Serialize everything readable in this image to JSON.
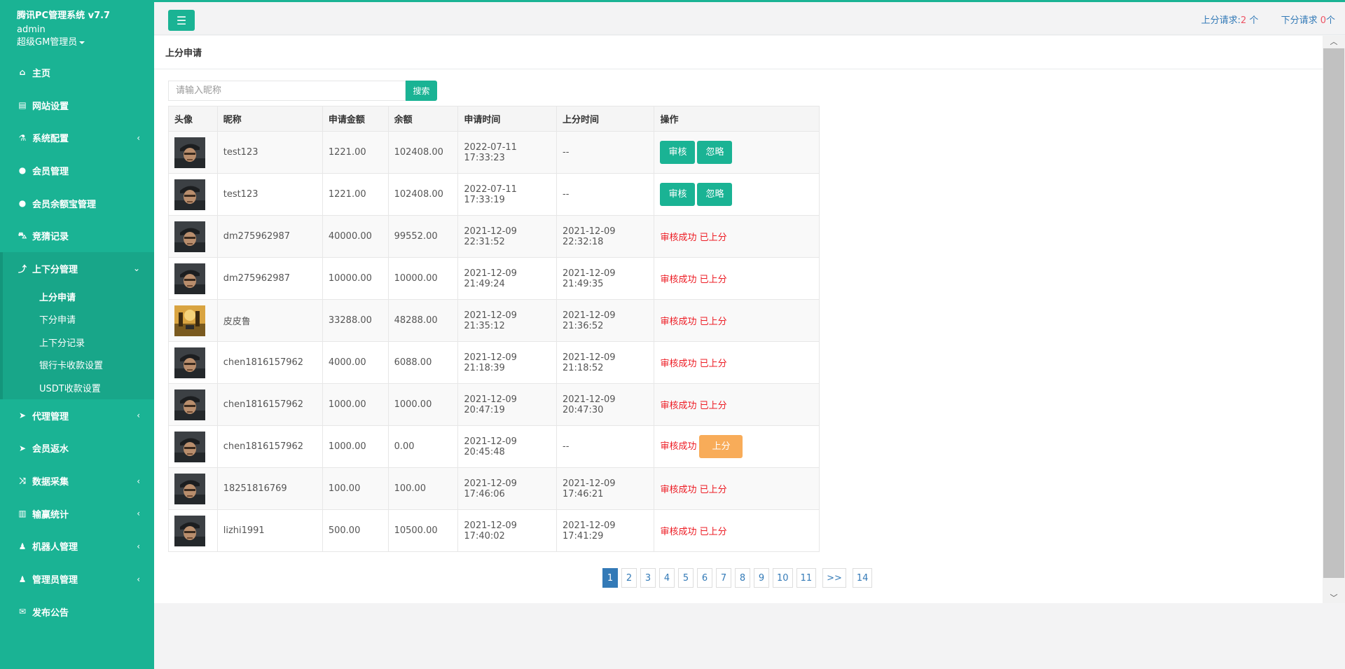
{
  "sidebar": {
    "app_title": "腾讯PC管理系统 v7.7",
    "username": "admin",
    "role": "超级GM管理员",
    "items": [
      {
        "label": "主页",
        "icon": "⌂",
        "arrow": ""
      },
      {
        "label": "网站设置",
        "icon": "▤",
        "arrow": ""
      },
      {
        "label": "系统配置",
        "icon": "⚗",
        "arrow": "‹"
      },
      {
        "label": "会员管理",
        "icon": "●",
        "arrow": ""
      },
      {
        "label": "会员余额宝管理",
        "icon": "●",
        "arrow": ""
      },
      {
        "label": "竞猜记录",
        "icon": "⛍",
        "arrow": ""
      },
      {
        "label": "上下分管理",
        "icon": "⤴",
        "arrow": "⌄"
      },
      {
        "label": "代理管理",
        "icon": "➤",
        "arrow": "‹"
      },
      {
        "label": "会员返水",
        "icon": "➤",
        "arrow": ""
      },
      {
        "label": "数据采集",
        "icon": "⤨",
        "arrow": "‹"
      },
      {
        "label": "输赢统计",
        "icon": "▥",
        "arrow": "‹"
      },
      {
        "label": "机器人管理",
        "icon": "♟",
        "arrow": "‹"
      },
      {
        "label": "管理员管理",
        "icon": "♟",
        "arrow": "‹"
      },
      {
        "label": "发布公告",
        "icon": "✉",
        "arrow": ""
      }
    ],
    "subitems": [
      "上分申请",
      "下分申请",
      "上下分记录",
      "银行卡收款设置",
      "USDT收款设置"
    ]
  },
  "topbar": {
    "up_label": "上分请求:",
    "up_count": "2",
    "up_unit": " 个",
    "down_label": "下分请求 ",
    "down_count": "0",
    "down_unit": "个"
  },
  "panel": {
    "title": "上分申请"
  },
  "search": {
    "placeholder": "请输入昵称",
    "button": "搜索"
  },
  "table": {
    "headers": [
      "头像",
      "昵称",
      "申请金额",
      "余额",
      "申请时间",
      "上分时间",
      "操作"
    ],
    "approve_label": "审核",
    "ignore_label": "忽略",
    "rows": [
      {
        "avatar": "soldier",
        "nickname": "test123",
        "amount": "1221.00",
        "balance": "102408.00",
        "apply_time": "2022-07-11 17:33:23",
        "credit_time": "--",
        "state": "pending"
      },
      {
        "avatar": "soldier",
        "nickname": "test123",
        "amount": "1221.00",
        "balance": "102408.00",
        "apply_time": "2022-07-11 17:33:19",
        "credit_time": "--",
        "state": "pending"
      },
      {
        "avatar": "soldier",
        "nickname": "dm275962987",
        "amount": "40000.00",
        "balance": "99552.00",
        "apply_time": "2021-12-09 22:31:52",
        "credit_time": "2021-12-09 22:32:18",
        "state": "done",
        "status_text": "审核成功 已上分"
      },
      {
        "avatar": "soldier",
        "nickname": "dm275962987",
        "amount": "10000.00",
        "balance": "10000.00",
        "apply_time": "2021-12-09 21:49:24",
        "credit_time": "2021-12-09 21:49:35",
        "state": "done",
        "status_text": "审核成功 已上分"
      },
      {
        "avatar": "landscape",
        "nickname": "皮皮鲁",
        "amount": "33288.00",
        "balance": "48288.00",
        "apply_time": "2021-12-09 21:35:12",
        "credit_time": "2021-12-09 21:36:52",
        "state": "done",
        "status_text": "审核成功 已上分"
      },
      {
        "avatar": "soldier",
        "nickname": "chen1816157962",
        "amount": "4000.00",
        "balance": "6088.00",
        "apply_time": "2021-12-09 21:18:39",
        "credit_time": "2021-12-09 21:18:52",
        "state": "done",
        "status_text": "审核成功 已上分"
      },
      {
        "avatar": "soldier",
        "nickname": "chen1816157962",
        "amount": "1000.00",
        "balance": "1000.00",
        "apply_time": "2021-12-09 20:47:19",
        "credit_time": "2021-12-09 20:47:30",
        "state": "done",
        "status_text": "审核成功 已上分"
      },
      {
        "avatar": "soldier",
        "nickname": "chen1816157962",
        "amount": "1000.00",
        "balance": "0.00",
        "apply_time": "2021-12-09 20:45:48",
        "credit_time": "--",
        "state": "approved",
        "status_text": "审核成功",
        "action_label": "上分"
      },
      {
        "avatar": "soldier",
        "nickname": "18251816769",
        "amount": "100.00",
        "balance": "100.00",
        "apply_time": "2021-12-09 17:46:06",
        "credit_time": "2021-12-09 17:46:21",
        "state": "done",
        "status_text": "审核成功 已上分"
      },
      {
        "avatar": "soldier",
        "nickname": "lizhi1991",
        "amount": "500.00",
        "balance": "10500.00",
        "apply_time": "2021-12-09 17:40:02",
        "credit_time": "2021-12-09 17:41:29",
        "state": "done",
        "status_text": "审核成功 已上分"
      }
    ]
  },
  "pagination": {
    "pages": [
      "1",
      "2",
      "3",
      "4",
      "5",
      "6",
      "7",
      "8",
      "9",
      "10",
      "11"
    ],
    "next": ">>",
    "last": "14",
    "current": "1"
  },
  "colors": {
    "accent": "#1ab394",
    "link": "#337ab7",
    "danger": "#ed1c24",
    "warning": "#f8ac59"
  }
}
